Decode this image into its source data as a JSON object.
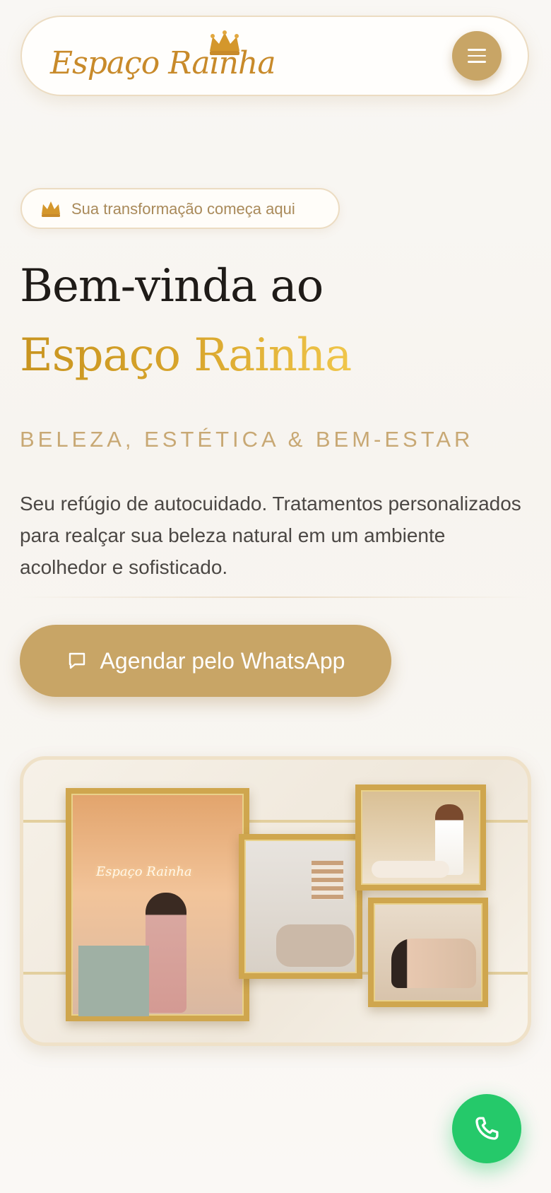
{
  "header": {
    "logo_text": "Espaço Rainha",
    "menu_icon": "hamburger-menu-icon"
  },
  "hero": {
    "badge_icon": "crown-icon",
    "badge_text": "Sua transformação começa aqui",
    "title_line1": "Bem-vinda ao",
    "title_line2": "Espaço Rainha",
    "tagline": "BELEZA, ESTÉTICA & BEM-ESTAR",
    "description": "Seu refúgio de autocuidado. Tratamentos personalizados para realçar sua beleza natural em um ambiente acolhedor e sofisticado.",
    "cta_label": "Agendar pelo WhatsApp",
    "cta_icon": "chat-bubble-icon"
  },
  "gallery": {
    "image_label": "Espaço Rainha"
  },
  "fab": {
    "icon": "phone-icon"
  },
  "colors": {
    "gold": "#c8a566",
    "gold_text": "#c8941f",
    "whatsapp_green": "#25c96a",
    "heading": "#1f1b18"
  }
}
